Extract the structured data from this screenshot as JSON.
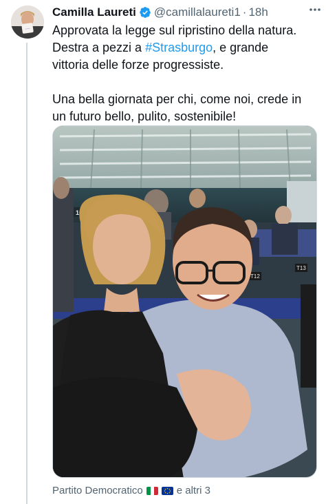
{
  "tweet": {
    "author": {
      "display_name": "Camilla Laureti",
      "handle": "@camillalaureti1",
      "verified": true,
      "avatar_icon": "avatar-photo"
    },
    "separator": "·",
    "timestamp": "18h",
    "more_icon": "more-horizontal-icon",
    "text": {
      "line1": "Approvata la legge sul ripristino della natura.",
      "line2_before": "Destra a pezzi a ",
      "hashtag": "#Strasburgo",
      "line2_after": ", e grande",
      "line3": "vittoria delle forze progressiste.",
      "line4": "Una bella giornata per chi, come noi, crede in",
      "line5": "un futuro bello, pulito, sostenibile!"
    },
    "media": {
      "kind": "photo",
      "seat_labels": [
        "10 FI",
        "T12",
        "T13"
      ]
    },
    "tagged": {
      "first": "Partito Democratico",
      "flags": [
        "italy-flag-icon",
        "eu-flag-icon"
      ],
      "others": "e altri 3"
    }
  },
  "colors": {
    "text_primary": "#0f1419",
    "text_secondary": "#536471",
    "link": "#1d9bf0",
    "verified": "#1d9bf0",
    "thread_line": "#cfd9de"
  }
}
